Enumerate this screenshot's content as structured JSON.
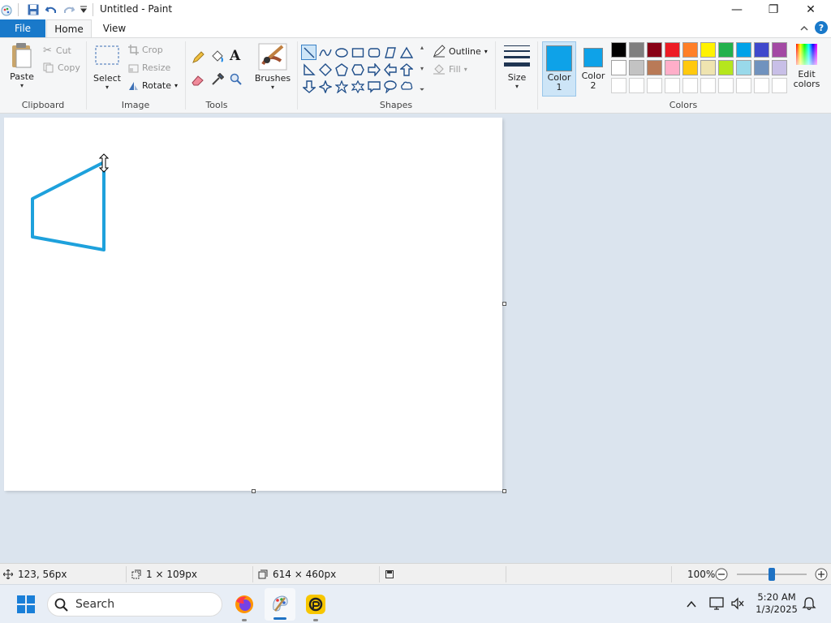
{
  "window": {
    "title": "Untitled - Paint",
    "minimize": "—",
    "maximize": "❐",
    "close": "✕"
  },
  "tabs": {
    "file": "File",
    "home": "Home",
    "view": "View"
  },
  "clipboard": {
    "paste": "Paste",
    "cut": "Cut",
    "copy": "Copy",
    "group": "Clipboard"
  },
  "image": {
    "select": "Select",
    "crop": "Crop",
    "resize": "Resize",
    "rotate": "Rotate",
    "group": "Image"
  },
  "tools": {
    "group": "Tools",
    "text_tool_glyph": "A"
  },
  "brushes": {
    "label": "Brushes"
  },
  "shapes": {
    "group": "Shapes",
    "outline": "Outline",
    "fill": "Fill"
  },
  "size": {
    "label": "Size"
  },
  "colors": {
    "color1_label": "Color",
    "color1_num": "1",
    "color2_label": "Color",
    "color2_num": "2",
    "color1_value": "#0ea2e8",
    "color2_value": "#0ea2e8",
    "edit_label_1": "Edit",
    "edit_label_2": "colors",
    "group": "Colors",
    "row1": [
      "#000000",
      "#7f7f7f",
      "#880015",
      "#ed1c24",
      "#ff7f27",
      "#fff200",
      "#22b14c",
      "#00a2e8",
      "#3f48cc",
      "#a349a4"
    ],
    "row2": [
      "#ffffff",
      "#c3c3c3",
      "#b97a57",
      "#ffaec9",
      "#ffc90e",
      "#efe4b0",
      "#b5e61d",
      "#99d9ea",
      "#7092be",
      "#c8bfe7"
    ]
  },
  "drawing": {
    "stroke_color": "#1ea1dc"
  },
  "status": {
    "cursor_pos": "123, 56px",
    "selection_size": "1 × 109px",
    "canvas_size": "614 × 460px",
    "zoom": "100%",
    "zoom_level": 0.5
  },
  "taskbar": {
    "search_placeholder": "Search",
    "time": "5:20 AM",
    "date": "1/3/2025"
  }
}
